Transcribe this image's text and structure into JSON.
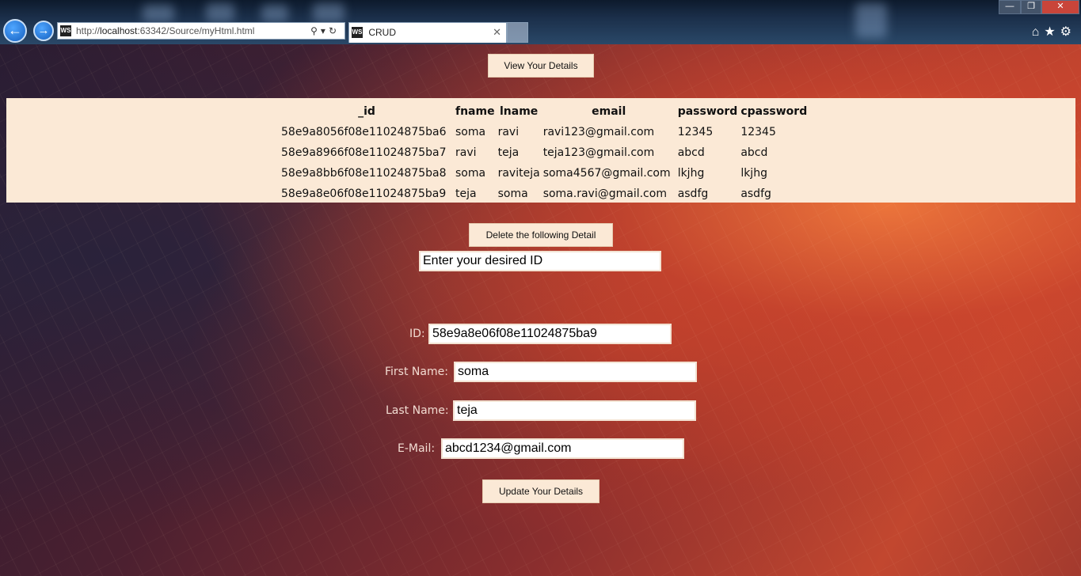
{
  "browser": {
    "url_prefix": "http://",
    "url_host": "localhost",
    "url_rest": ":63342/Source/myHtml.html",
    "tab_title": "CRUD",
    "favicon_text": "WS"
  },
  "view_button_label": "View Your Details",
  "table": {
    "headers": [
      "_id",
      "fname",
      "lname",
      "email",
      "password",
      "cpassword"
    ],
    "rows": [
      [
        "58e9a8056f08e11024875ba6",
        "soma",
        "ravi",
        "ravi123@gmail.com",
        "12345",
        "12345"
      ],
      [
        "58e9a8966f08e11024875ba7",
        "ravi",
        "teja",
        "teja123@gmail.com",
        "abcd",
        "abcd"
      ],
      [
        "58e9a8bb6f08e11024875ba8",
        "soma",
        "raviteja",
        "soma4567@gmail.com",
        "lkjhg",
        "lkjhg"
      ],
      [
        "58e9a8e06f08e11024875ba9",
        "teja",
        "soma",
        "soma.ravi@gmail.com",
        "asdfg",
        "asdfg"
      ]
    ]
  },
  "delete": {
    "button_label": "Delete the following Detail",
    "input_value": "Enter your desired ID"
  },
  "form": {
    "id_label": "ID:",
    "id_value": "58e9a8e06f08e11024875ba9",
    "first_name_label": "First Name:",
    "first_name_value": "soma",
    "last_name_label": "Last Name:",
    "last_name_value": "teja",
    "email_label": "E-Mail:",
    "email_value": "abcd1234@gmail.com",
    "update_button_label": "Update Your Details"
  }
}
